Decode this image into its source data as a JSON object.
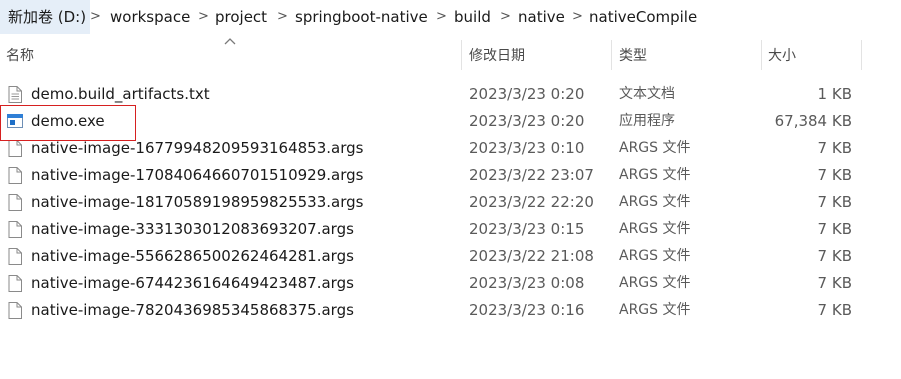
{
  "breadcrumb": {
    "items": [
      "新加卷 (D:)",
      "workspace",
      "project",
      "springboot-native",
      "build",
      "native",
      "nativeCompile"
    ],
    "separator": ">"
  },
  "columns": {
    "name": "名称",
    "date": "修改日期",
    "type": "类型",
    "size": "大小"
  },
  "files": [
    {
      "name": "demo.build_artifacts.txt",
      "date": "2023/3/23 0:20",
      "type": "文本文档",
      "size": "1 KB",
      "icon": "text-file-icon"
    },
    {
      "name": "demo.exe",
      "date": "2023/3/23 0:20",
      "type": "应用程序",
      "size": "67,384 KB",
      "icon": "exe-file-icon"
    },
    {
      "name": "native-image-16779948209593164853.args",
      "date": "2023/3/23 0:10",
      "type": "ARGS 文件",
      "size": "7 KB",
      "icon": "blank-file-icon"
    },
    {
      "name": "native-image-17084064660701510929.args",
      "date": "2023/3/22 23:07",
      "type": "ARGS 文件",
      "size": "7 KB",
      "icon": "blank-file-icon"
    },
    {
      "name": "native-image-18170589198959825533.args",
      "date": "2023/3/22 22:20",
      "type": "ARGS 文件",
      "size": "7 KB",
      "icon": "blank-file-icon"
    },
    {
      "name": "native-image-3331303012083693207.args",
      "date": "2023/3/23 0:15",
      "type": "ARGS 文件",
      "size": "7 KB",
      "icon": "blank-file-icon"
    },
    {
      "name": "native-image-5566286500262464281.args",
      "date": "2023/3/22 21:08",
      "type": "ARGS 文件",
      "size": "7 KB",
      "icon": "blank-file-icon"
    },
    {
      "name": "native-image-6744236164649423487.args",
      "date": "2023/3/23 0:08",
      "type": "ARGS 文件",
      "size": "7 KB",
      "icon": "blank-file-icon"
    },
    {
      "name": "native-image-7820436985345868375.args",
      "date": "2023/3/23 0:16",
      "type": "ARGS 文件",
      "size": "7 KB",
      "icon": "blank-file-icon"
    }
  ],
  "colors": {
    "breadcrumb_highlight": "#e5eef8",
    "annotation_box": "#d62020",
    "exe_icon": "#1e6fc7"
  }
}
